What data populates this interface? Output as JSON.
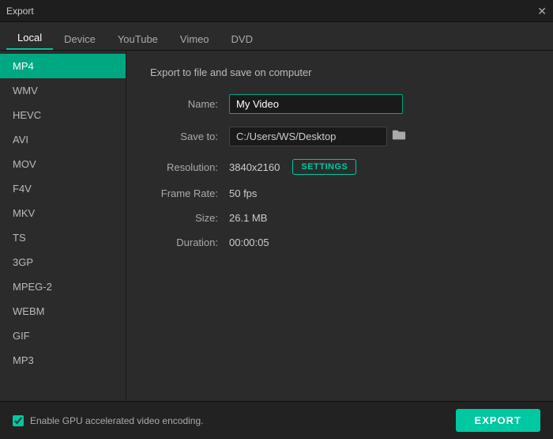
{
  "titlebar": {
    "title": "Export",
    "close": "✕"
  },
  "tabs": [
    {
      "id": "local",
      "label": "Local",
      "active": true
    },
    {
      "id": "device",
      "label": "Device",
      "active": false
    },
    {
      "id": "youtube",
      "label": "YouTube",
      "active": false
    },
    {
      "id": "vimeo",
      "label": "Vimeo",
      "active": false
    },
    {
      "id": "dvd",
      "label": "DVD",
      "active": false
    }
  ],
  "sidebar": {
    "items": [
      {
        "id": "mp4",
        "label": "MP4",
        "active": true
      },
      {
        "id": "wmv",
        "label": "WMV",
        "active": false
      },
      {
        "id": "hevc",
        "label": "HEVC",
        "active": false
      },
      {
        "id": "avi",
        "label": "AVI",
        "active": false
      },
      {
        "id": "mov",
        "label": "MOV",
        "active": false
      },
      {
        "id": "f4v",
        "label": "F4V",
        "active": false
      },
      {
        "id": "mkv",
        "label": "MKV",
        "active": false
      },
      {
        "id": "ts",
        "label": "TS",
        "active": false
      },
      {
        "id": "3gp",
        "label": "3GP",
        "active": false
      },
      {
        "id": "mpeg2",
        "label": "MPEG-2",
        "active": false
      },
      {
        "id": "webm",
        "label": "WEBM",
        "active": false
      },
      {
        "id": "gif",
        "label": "GIF",
        "active": false
      },
      {
        "id": "mp3",
        "label": "MP3",
        "active": false
      }
    ]
  },
  "content": {
    "title": "Export to file and save on computer",
    "fields": {
      "name_label": "Name:",
      "name_value": "My Video",
      "saveto_label": "Save to:",
      "saveto_path": "C:/Users/WS/Desktop",
      "resolution_label": "Resolution:",
      "resolution_value": "3840x2160",
      "settings_btn": "SETTINGS",
      "framerate_label": "Frame Rate:",
      "framerate_value": "50 fps",
      "size_label": "Size:",
      "size_value": "26.1 MB",
      "duration_label": "Duration:",
      "duration_value": "00:00:05"
    }
  },
  "footer": {
    "checkbox_label": "Enable GPU accelerated video encoding.",
    "export_btn": "EXPORT"
  }
}
